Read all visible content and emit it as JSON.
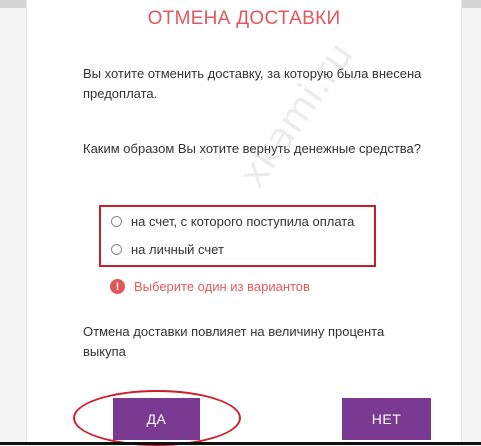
{
  "dialog": {
    "title": "ОТМЕНА ДОСТАВКИ",
    "prompt_prepaid": "Вы хотите отменить доставку, за которую была внесена предоплата.",
    "prompt_refund": "Каким образом Вы хотите вернуть денежные средства?",
    "options": [
      {
        "label": "на счет, с которого поступила оплата",
        "selected": false
      },
      {
        "label": "на личный счет",
        "selected": false
      }
    ],
    "error": {
      "icon": "exclamation-circle-icon",
      "text": "Выберите один из вариантов"
    },
    "notice": "Отмена доставки повлияет на величину процента выкупа",
    "buttons": {
      "yes": "ДА",
      "no": "НЕТ"
    }
  },
  "watermark": "xkami.ru",
  "colors": {
    "title": "#e05860",
    "error": "#e05b5b",
    "button": "#7b3a92",
    "highlight": "#cc1f2b"
  }
}
